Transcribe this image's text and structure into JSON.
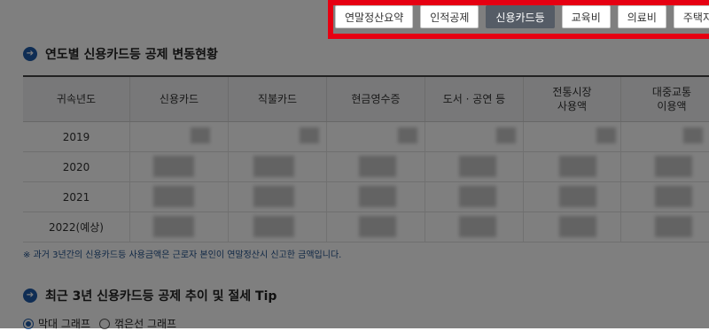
{
  "tabs": [
    {
      "label": "연말정산요약",
      "active": false
    },
    {
      "label": "인적공제",
      "active": false
    },
    {
      "label": "신용카드등",
      "active": true
    },
    {
      "label": "교육비",
      "active": false
    },
    {
      "label": "의료비",
      "active": false
    },
    {
      "label": "주택자금",
      "active": false
    }
  ],
  "section1": {
    "title": "연도별 신용카드등 공제 변동현황",
    "icon": "arrow-circle-icon"
  },
  "table": {
    "headers": [
      "귀속년도",
      "신용카드",
      "직불카드",
      "현금영수증",
      "도서 · 공연 등",
      "전통시장\n사용액",
      "대중교통\n이용액"
    ],
    "rows": [
      {
        "year": "2019"
      },
      {
        "year": "2020"
      },
      {
        "year": "2021"
      },
      {
        "year": "2022(예상)"
      }
    ]
  },
  "note": "※ 과거 3년간의 신용카드등 사용금액은 근로자 본인이 연말정산시 신고한 금액입니다.",
  "section2": {
    "title": "최근 3년 신용카드등 공제 추이 및 절세 Tip",
    "icon": "arrow-circle-icon"
  },
  "chart_toggle": {
    "options": [
      {
        "label": "막대 그래프",
        "selected": true
      },
      {
        "label": "꺾은선 그래프",
        "selected": false
      }
    ]
  },
  "colors": {
    "accent": "#1f5aa8",
    "active_tab": "#555c66",
    "highlight": "#e60012"
  }
}
